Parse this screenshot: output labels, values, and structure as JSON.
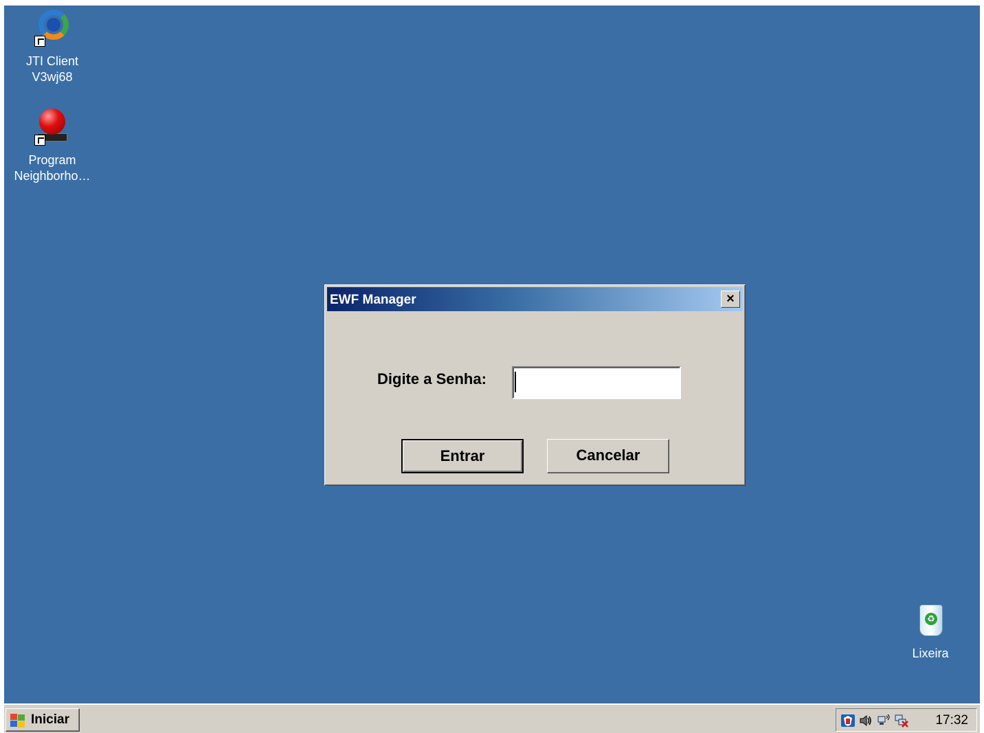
{
  "desktop": {
    "background": "#3a6ea5",
    "icons": [
      {
        "label_line1": "JTI Client",
        "label_line2": "V3wj68",
        "icon": "jti-client-icon"
      },
      {
        "label_line1": "Program",
        "label_line2": "Neighborho…",
        "icon": "program-neighborhood-icon"
      },
      {
        "label_line1": "Lixeira",
        "icon": "recycle-bin-icon"
      }
    ]
  },
  "dialog": {
    "title": "EWF Manager",
    "close_label": "×",
    "password_label": "Digite a Senha:",
    "password_value": "",
    "ok_label": "Entrar",
    "cancel_label": "Cancelar"
  },
  "taskbar": {
    "start_label": "Iniciar",
    "clock": "17:32",
    "tray_icons": [
      "shield-icon",
      "volume-icon",
      "network-icon",
      "disconnected-network-icon"
    ]
  }
}
